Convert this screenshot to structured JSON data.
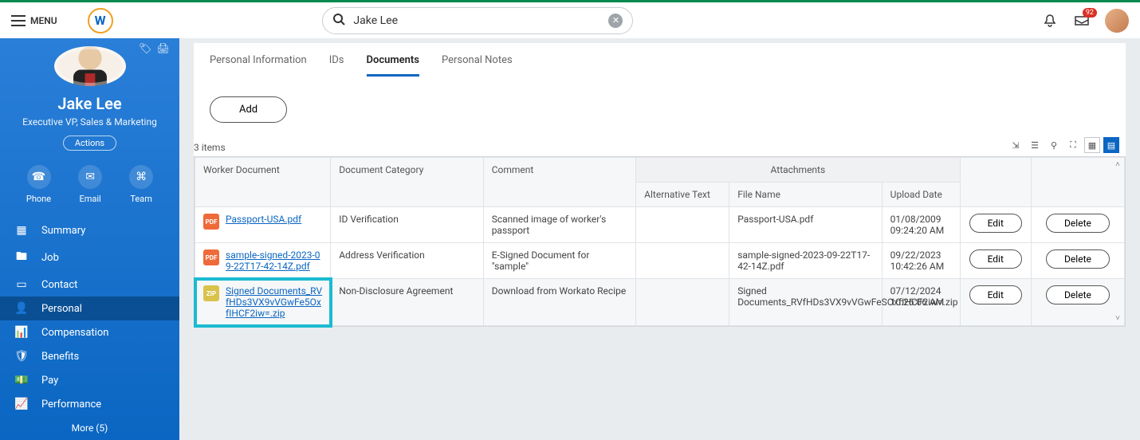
{
  "topbar": {
    "menu_label": "MENU",
    "logo_letter": "W",
    "search_value": "Jake Lee",
    "inbox_badge": "92"
  },
  "profile": {
    "name": "Jake Lee",
    "title": "Executive VP, Sales & Marketing",
    "actions_label": "Actions",
    "quick": {
      "phone": "Phone",
      "email": "Email",
      "team": "Team"
    }
  },
  "nav": {
    "items": [
      {
        "label": "Summary",
        "active": false
      },
      {
        "label": "Job",
        "active": false
      },
      {
        "label": "Contact",
        "active": false
      },
      {
        "label": "Personal",
        "active": true
      },
      {
        "label": "Compensation",
        "active": false
      },
      {
        "label": "Benefits",
        "active": false
      },
      {
        "label": "Pay",
        "active": false
      },
      {
        "label": "Performance",
        "active": false
      }
    ],
    "more_label": "More (5)"
  },
  "tabs": {
    "items": [
      "Personal Information",
      "IDs",
      "Documents",
      "Personal Notes"
    ],
    "active_index": 2
  },
  "main": {
    "add_label": "Add",
    "item_count": "3 items",
    "group_header": "Attachments",
    "headers": {
      "worker_document": "Worker Document",
      "document_category": "Document Category",
      "comment": "Comment",
      "alt_text": "Alternative Text",
      "file_name": "File Name",
      "upload_date": "Upload Date"
    },
    "buttons": {
      "edit": "Edit",
      "delete": "Delete"
    },
    "rows": [
      {
        "doc": "Passport-USA.pdf",
        "ftype": "pdf",
        "category": "ID Verification",
        "comment": "Scanned image of worker's passport",
        "alt": "",
        "filename": "Passport-USA.pdf",
        "upload_date": "01/08/2009",
        "upload_time": "09:24:20 AM"
      },
      {
        "doc": "sample-signed-2023-09-22T17-42-14Z.pdf",
        "ftype": "pdf",
        "category": "Address Verification",
        "comment": "E-Signed Document for \"sample\"",
        "alt": "",
        "filename": "sample-signed-2023-09-22T17-42-14Z.pdf",
        "upload_date": "09/22/2023",
        "upload_time": "10:42:26 AM"
      },
      {
        "doc": "Signed Documents_RVfHDs3VX9vVGwFe5OxfIHCF2iw=.zip",
        "ftype": "zip",
        "category": "Non-Disclosure Agreement",
        "comment": "Download from Workato Recipe",
        "alt": "",
        "filename": "Signed Documents_RVfHDs3VX9vVGwFeSOxfIHCF2iw=.zip",
        "upload_date": "07/12/2024",
        "upload_time": "10:26:06 AM"
      }
    ]
  }
}
